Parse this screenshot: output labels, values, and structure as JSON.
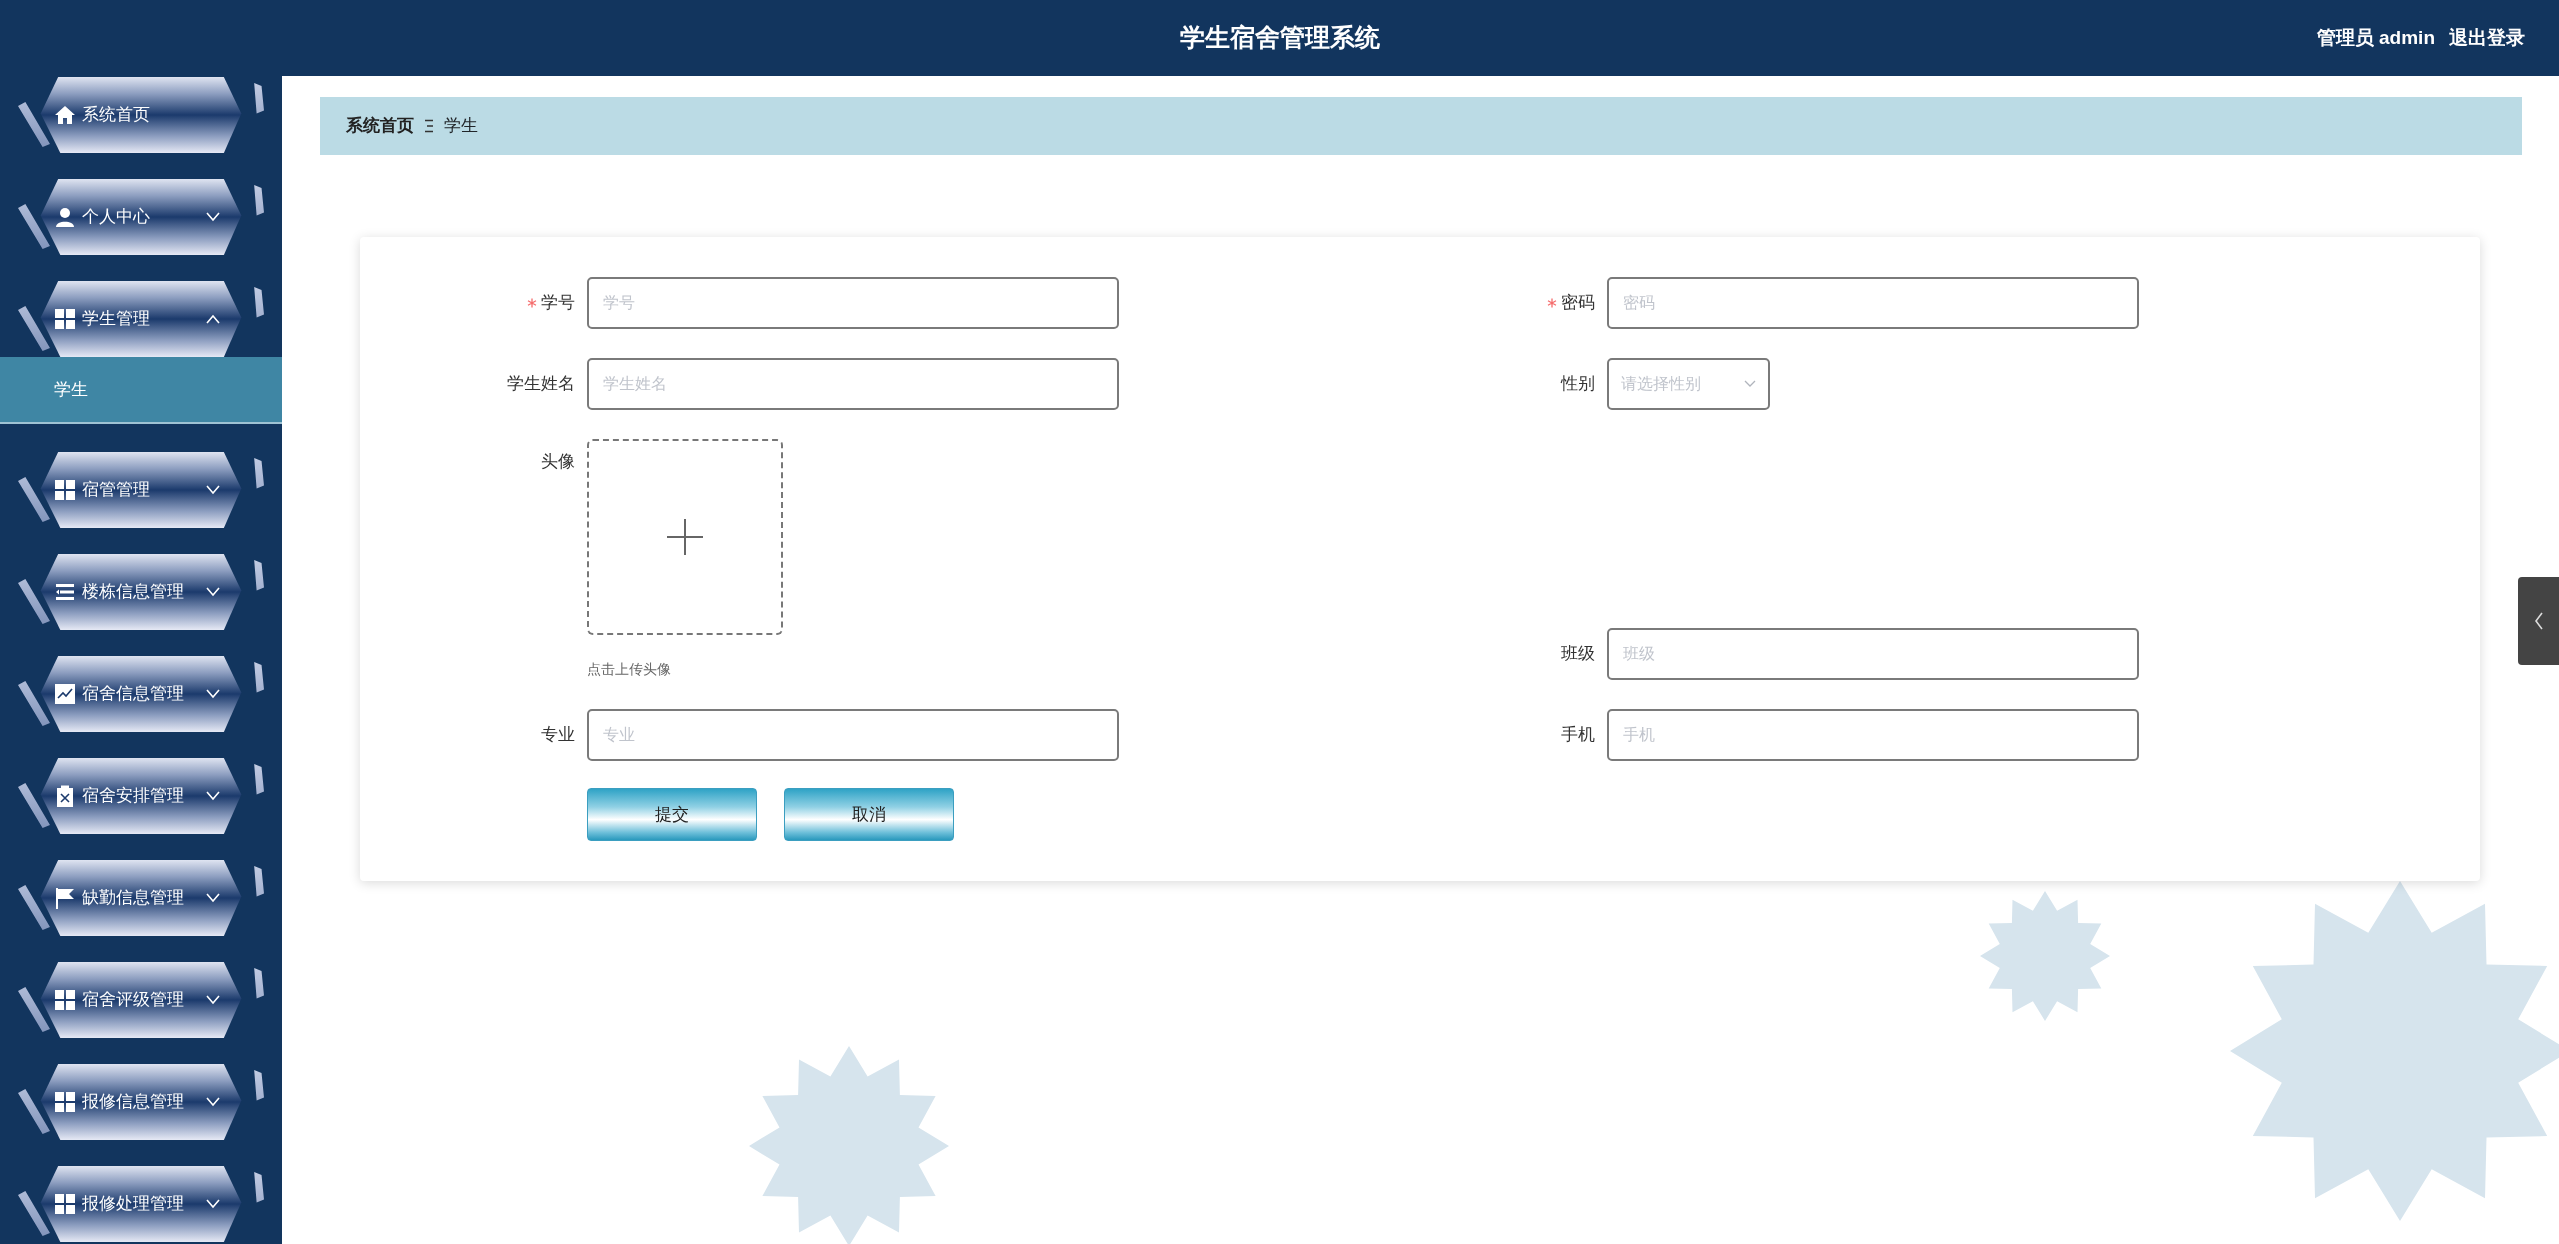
{
  "header": {
    "title": "学生宿舍管理系统",
    "user": "管理员 admin",
    "logout": "退出登录"
  },
  "sidebar": {
    "items": [
      {
        "label": "系统首页",
        "kind": "link"
      },
      {
        "label": "个人中心",
        "kind": "group",
        "expanded": false
      },
      {
        "label": "学生管理",
        "kind": "group",
        "expanded": true,
        "children": [
          {
            "label": "学生",
            "selected": true
          }
        ]
      },
      {
        "label": "宿管管理",
        "kind": "group",
        "expanded": false
      },
      {
        "label": "楼栋信息管理",
        "kind": "group",
        "expanded": false
      },
      {
        "label": "宿舍信息管理",
        "kind": "group",
        "expanded": false
      },
      {
        "label": "宿舍安排管理",
        "kind": "group",
        "expanded": false
      },
      {
        "label": "缺勤信息管理",
        "kind": "group",
        "expanded": false
      },
      {
        "label": "宿舍评级管理",
        "kind": "group",
        "expanded": false
      },
      {
        "label": "报修信息管理",
        "kind": "group",
        "expanded": false
      },
      {
        "label": "报修处理管理",
        "kind": "group",
        "expanded": false
      }
    ]
  },
  "breadcrumb": [
    "系统首页",
    "学生"
  ],
  "form": {
    "rows": [
      [
        {
          "kind": "input",
          "label": "学号",
          "required": true,
          "placeholder": "学号"
        },
        {
          "kind": "input",
          "label": "密码",
          "required": true,
          "placeholder": "密码"
        }
      ],
      [
        {
          "kind": "input",
          "label": "学生姓名",
          "required": false,
          "placeholder": "学生姓名"
        },
        {
          "kind": "select",
          "label": "性别",
          "required": false,
          "placeholder": "请选择性别"
        }
      ],
      [
        {
          "kind": "upload",
          "label": "头像",
          "required": false,
          "hint": "点击上传头像"
        },
        {
          "kind": "input",
          "label": "班级",
          "required": false,
          "placeholder": "班级"
        }
      ],
      [
        {
          "kind": "input",
          "label": "专业",
          "required": false,
          "placeholder": "专业"
        },
        {
          "kind": "input",
          "label": "手机",
          "required": false,
          "placeholder": "手机"
        }
      ]
    ],
    "buttons": [
      "提交",
      "取消"
    ]
  }
}
